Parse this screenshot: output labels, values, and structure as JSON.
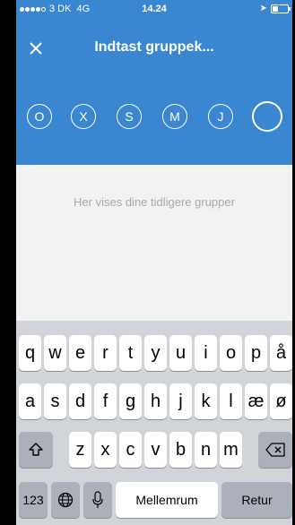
{
  "status_bar": {
    "carrier": "3 DK",
    "network": "4G",
    "time": "14.24",
    "battery_level": 0.35
  },
  "header": {
    "title": "Indtast gruppek...",
    "group_letters": [
      "O",
      "X",
      "S",
      "M",
      "J",
      ""
    ]
  },
  "content": {
    "hint": "Her vises dine tidligere grupper"
  },
  "keyboard": {
    "row1": [
      "q",
      "w",
      "e",
      "r",
      "t",
      "y",
      "u",
      "i",
      "o",
      "p",
      "å"
    ],
    "row2": [
      "a",
      "s",
      "d",
      "f",
      "g",
      "h",
      "j",
      "k",
      "l",
      "æ",
      "ø"
    ],
    "row3": [
      "z",
      "x",
      "c",
      "v",
      "b",
      "n",
      "m"
    ],
    "numbers_label": "123",
    "space_label": "Mellemrum",
    "return_label": "Retur",
    "icons": {
      "shift": "shift-icon",
      "delete": "backspace-icon",
      "globe": "globe-icon",
      "mic": "microphone-icon",
      "close": "close-icon"
    }
  }
}
